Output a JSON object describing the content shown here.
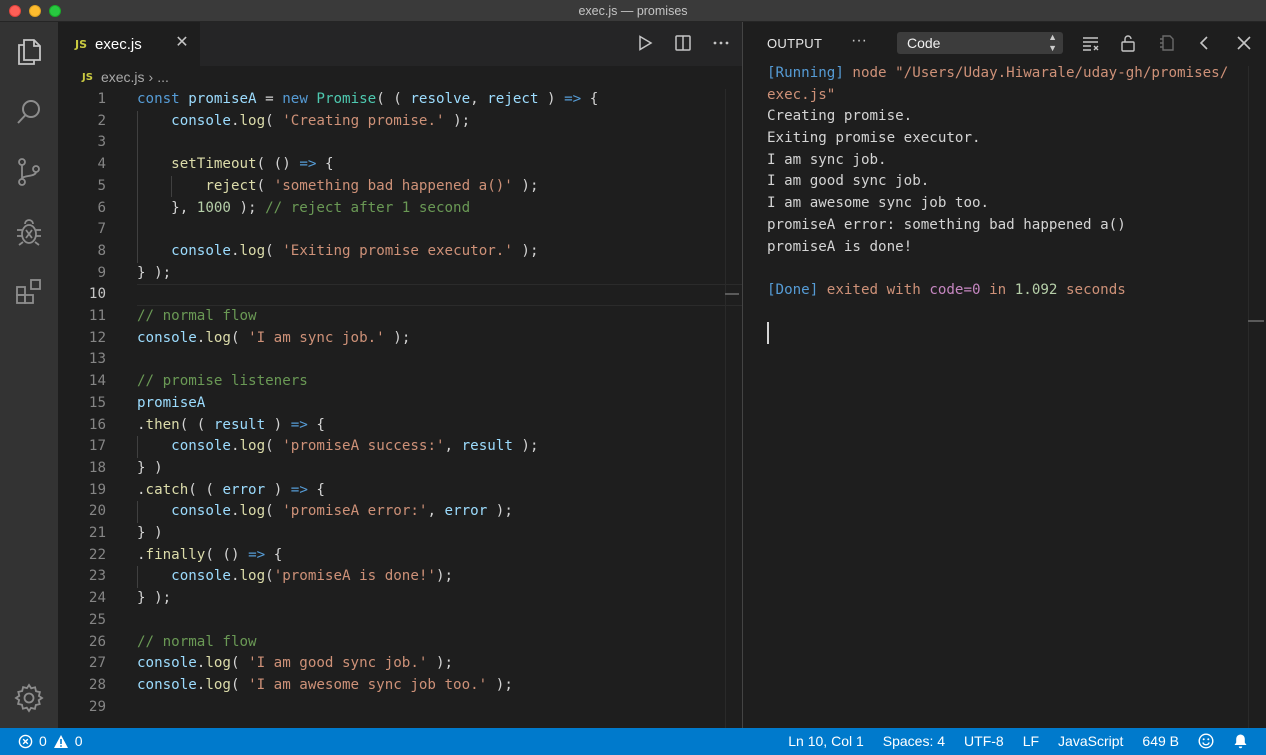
{
  "window": {
    "title": "exec.js — promises"
  },
  "editor": {
    "tab": {
      "badge": "JS",
      "label": "exec.js"
    },
    "breadcrumb": {
      "badge": "JS",
      "file": "exec.js",
      "more": "..."
    }
  },
  "code_lines": [
    {
      "n": "1",
      "html": "<span class='k'>const</span> <span class='v'>promiseA</span> = <span class='k'>new</span> <span class='c'>Promise</span>( ( <span class='v'>resolve</span>, <span class='v'>reject</span> ) <span class='k'>=&gt;</span> {"
    },
    {
      "n": "2",
      "html": "    <span class='v'>console</span>.<span class='f'>log</span>( <span class='s'>'Creating promise.'</span> );"
    },
    {
      "n": "3",
      "html": ""
    },
    {
      "n": "4",
      "html": "    <span class='f'>setTimeout</span>( () <span class='k'>=&gt;</span> {"
    },
    {
      "n": "5",
      "html": "        <span class='f'>reject</span>( <span class='s'>'something bad happened a()'</span> );"
    },
    {
      "n": "6",
      "html": "    }, <span class='n'>1000</span> ); <span class='cm'>// reject after 1 second</span>"
    },
    {
      "n": "7",
      "html": ""
    },
    {
      "n": "8",
      "html": "    <span class='v'>console</span>.<span class='f'>log</span>( <span class='s'>'Exiting promise executor.'</span> );"
    },
    {
      "n": "9",
      "html": "} );"
    },
    {
      "n": "10",
      "html": ""
    },
    {
      "n": "11",
      "html": "<span class='cm'>// normal flow</span>"
    },
    {
      "n": "12",
      "html": "<span class='v'>console</span>.<span class='f'>log</span>( <span class='s'>'I am sync job.'</span> );"
    },
    {
      "n": "13",
      "html": ""
    },
    {
      "n": "14",
      "html": "<span class='cm'>// promise listeners</span>"
    },
    {
      "n": "15",
      "html": "<span class='v'>promiseA</span>"
    },
    {
      "n": "16",
      "html": ".<span class='f'>then</span>( ( <span class='v'>result</span> ) <span class='k'>=&gt;</span> {"
    },
    {
      "n": "17",
      "html": "    <span class='v'>console</span>.<span class='f'>log</span>( <span class='s'>'promiseA success:'</span>, <span class='v'>result</span> );"
    },
    {
      "n": "18",
      "html": "} )"
    },
    {
      "n": "19",
      "html": ".<span class='f'>catch</span>( ( <span class='v'>error</span> ) <span class='k'>=&gt;</span> {"
    },
    {
      "n": "20",
      "html": "    <span class='v'>console</span>.<span class='f'>log</span>( <span class='s'>'promiseA error:'</span>, <span class='v'>error</span> );"
    },
    {
      "n": "21",
      "html": "} )"
    },
    {
      "n": "22",
      "html": ".<span class='f'>finally</span>( () <span class='k'>=&gt;</span> {"
    },
    {
      "n": "23",
      "html": "    <span class='v'>console</span>.<span class='f'>log</span>(<span class='s'>'promiseA is done!'</span>);"
    },
    {
      "n": "24",
      "html": "} );"
    },
    {
      "n": "25",
      "html": ""
    },
    {
      "n": "26",
      "html": "<span class='cm'>// normal flow</span>"
    },
    {
      "n": "27",
      "html": "<span class='v'>console</span>.<span class='f'>log</span>( <span class='s'>'I am good sync job.'</span> );"
    },
    {
      "n": "28",
      "html": "<span class='v'>console</span>.<span class='f'>log</span>( <span class='s'>'I am awesome sync job too.'</span> );"
    },
    {
      "n": "29",
      "html": ""
    }
  ],
  "active_line": "10",
  "output_panel": {
    "title": "OUTPUT",
    "more": "···",
    "channel": "Code",
    "lines": [
      "<span class='o-blue'>[Running]</span> <span class='o-orange'>node \"/Users/Uday.Hiwarale/uday-gh/promises/</span>",
      "<span class='o-orange'>exec.js\"</span>",
      "Creating promise.",
      "Exiting promise executor.",
      "I am sync job.",
      "I am good sync job.",
      "I am awesome sync job too.",
      "promiseA error: something bad happened a()",
      "promiseA is done!",
      "",
      "<span class='o-blue'>[Done]</span> <span class='o-orange'>exited with</span> <span class='o-purple'>code=0</span> <span class='o-orange'>in</span> <span class='o-num'>1.092</span> <span class='o-orange'>seconds</span>"
    ]
  },
  "status": {
    "errors": "0",
    "warnings": "0",
    "position": "Ln 10, Col 1",
    "spaces": "Spaces: 4",
    "encoding": "UTF-8",
    "eol": "LF",
    "language": "JavaScript",
    "size": "649 B"
  },
  "icons": {
    "activity": [
      "files-icon",
      "search-icon",
      "source-control-icon",
      "debug-icon",
      "extensions-icon",
      "settings-gear-icon"
    ],
    "editor_actions": [
      "run-icon",
      "split-editor-icon",
      "more-actions-icon"
    ],
    "panel_actions": [
      "clear-output-icon",
      "lock-scroll-icon",
      "open-log-icon",
      "chevron-left-icon",
      "close-panel-icon"
    ],
    "status": [
      "error-icon",
      "warning-icon",
      "feedback-smiley-icon",
      "bell-icon"
    ]
  }
}
